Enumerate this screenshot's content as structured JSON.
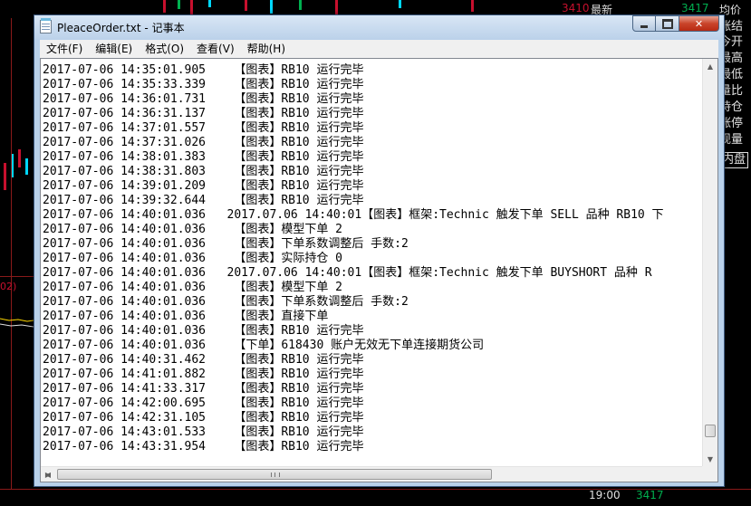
{
  "window": {
    "title": "PleaceOrder.txt - 记事本",
    "controls": {
      "min": "",
      "max": "",
      "close": "✕"
    }
  },
  "menu": [
    {
      "label": "文件(F)"
    },
    {
      "label": "编辑(E)"
    },
    {
      "label": "格式(O)"
    },
    {
      "label": "查看(V)"
    },
    {
      "label": "帮助(H)"
    }
  ],
  "lines": [
    "2017-07-06 14:35:01.905    【图表】RB10 运行完毕",
    "2017-07-06 14:35:33.339    【图表】RB10 运行完毕",
    "2017-07-06 14:36:01.731    【图表】RB10 运行完毕",
    "2017-07-06 14:36:31.137    【图表】RB10 运行完毕",
    "2017-07-06 14:37:01.557    【图表】RB10 运行完毕",
    "2017-07-06 14:37:31.026    【图表】RB10 运行完毕",
    "2017-07-06 14:38:01.383    【图表】RB10 运行完毕",
    "2017-07-06 14:38:31.803    【图表】RB10 运行完毕",
    "2017-07-06 14:39:01.209    【图表】RB10 运行完毕",
    "2017-07-06 14:39:32.644    【图表】RB10 运行完毕",
    "2017-07-06 14:40:01.036   2017.07.06 14:40:01【图表】框架:Technic 触发下单 SELL 品种 RB10 下",
    "2017-07-06 14:40:01.036    【图表】模型下单 2",
    "2017-07-06 14:40:01.036    【图表】下单系数调整后 手数:2",
    "2017-07-06 14:40:01.036    【图表】实际持仓 0",
    "2017-07-06 14:40:01.036   2017.07.06 14:40:01【图表】框架:Technic 触发下单 BUYSHORT 品种 R",
    "2017-07-06 14:40:01.036    【图表】模型下单 2",
    "2017-07-06 14:40:01.036    【图表】下单系数调整后 手数:2",
    "2017-07-06 14:40:01.036    【图表】直接下单",
    "2017-07-06 14:40:01.036    【图表】RB10 运行完毕",
    "2017-07-06 14:40:01.036    【下单】618430 账户无效无下单连接期货公司",
    "2017-07-06 14:40:31.462    【图表】RB10 运行完毕",
    "2017-07-06 14:41:01.882    【图表】RB10 运行完毕",
    "2017-07-06 14:41:33.317    【图表】RB10 运行完毕",
    "2017-07-06 14:42:00.695    【图表】RB10 运行完毕",
    "2017-07-06 14:42:31.105    【图表】RB10 运行完毕",
    "2017-07-06 14:43:01.533    【图表】RB10 运行完毕",
    "2017-07-06 14:43:31.954    【图表】RB10 运行完毕"
  ],
  "background": {
    "top_right": [
      "3410",
      "最新",
      "3417",
      "均价"
    ],
    "right_labels": [
      "涨结",
      "今开",
      "最高",
      "最低",
      "量比",
      "持仓",
      "涨停",
      "现量",
      "内盘"
    ],
    "left_label": "02)",
    "bottom_time": "19:00",
    "bottom_price": "3417",
    "colors": {
      "red": "#c8102e",
      "green": "#00b050",
      "cyan": "#00d8ff",
      "yellow": "#ffd800"
    }
  },
  "icons": {
    "app": "notepad-icon"
  }
}
